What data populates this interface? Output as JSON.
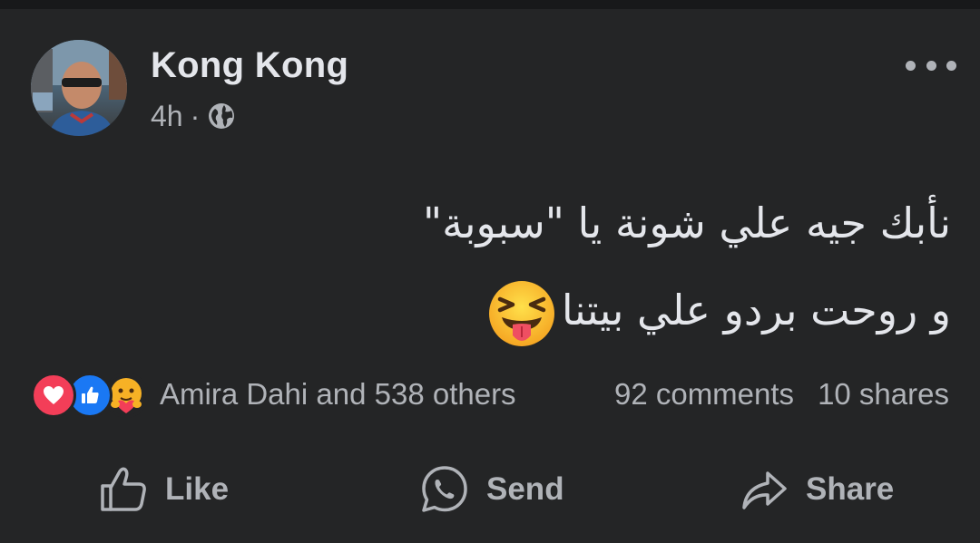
{
  "post": {
    "author": "Kong Kong",
    "time": "4h",
    "separator": "·",
    "privacy_icon": "globe-icon",
    "text_line1": "نأبك جيه علي شونة  يا \"سبوبة\"",
    "text_line2": "و روحت بردو علي بيتنا",
    "emoji": "squinting-face-with-tongue"
  },
  "reactions": {
    "icons": [
      "love-reaction-icon",
      "like-reaction-icon",
      "care-reaction-icon"
    ],
    "summary": "Amira Dahi and 538 others",
    "comments": "92 comments",
    "shares": "10 shares"
  },
  "actions": {
    "like_label": "Like",
    "send_label": "Send",
    "share_label": "Share"
  },
  "colors": {
    "background": "#242526",
    "text_primary": "#e4e6eb",
    "text_secondary": "#b0b3b8",
    "love": "#f33e58",
    "like": "#1a78f4"
  }
}
